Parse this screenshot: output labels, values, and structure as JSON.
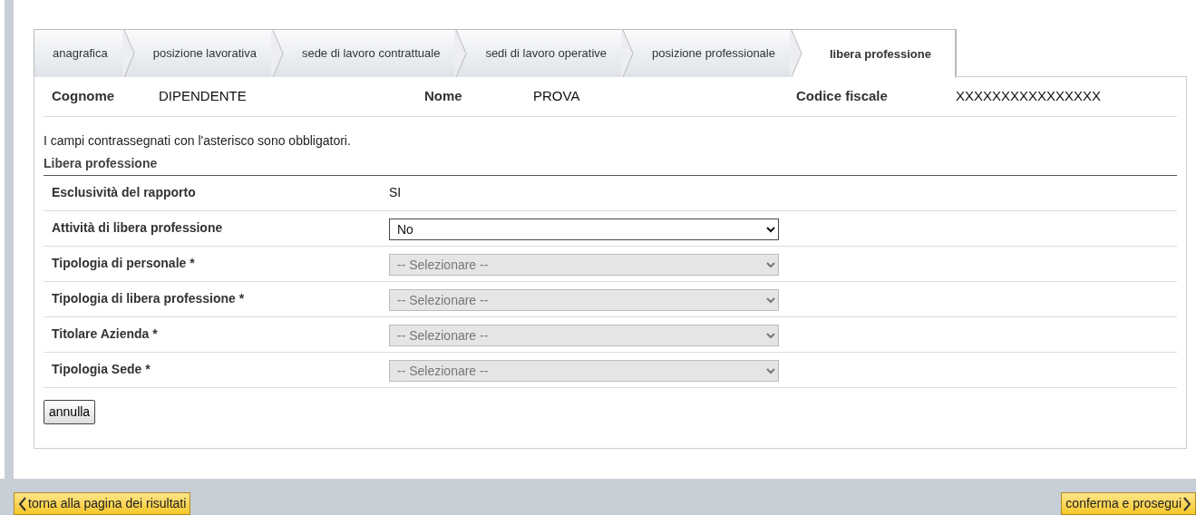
{
  "tabs": [
    {
      "label": "anagrafica",
      "selected": false
    },
    {
      "label": "posizione lavorativa",
      "selected": false
    },
    {
      "label": "sede di lavoro contrattuale",
      "selected": false
    },
    {
      "label": "sedi di lavoro operative",
      "selected": false
    },
    {
      "label": "posizione professionale",
      "selected": false
    },
    {
      "label": "libera professione",
      "selected": true
    }
  ],
  "header": [
    {
      "label": "Cognome",
      "value": "DIPENDENTE"
    },
    {
      "label": "Nome",
      "value": "PROVA"
    },
    {
      "label": "Codice fiscale",
      "value": "XXXXXXXXXXXXXXXX"
    }
  ],
  "note": "I campi contrassegnati con l'asterisco sono obbligatori.",
  "section_title": "Libera professione",
  "fields": [
    {
      "kind": "text",
      "label": "Esclusività del rapporto",
      "value": "SI"
    },
    {
      "kind": "select",
      "label": "Attività di libera professione",
      "value": "No",
      "disabled": false
    },
    {
      "kind": "select",
      "label": "Tipologia di personale *",
      "value": "-- Selezionare --",
      "disabled": true
    },
    {
      "kind": "select",
      "label": "Tipologia di libera professione *",
      "value": "-- Selezionare --",
      "disabled": true
    },
    {
      "kind": "select",
      "label": "Titolare Azienda *",
      "value": "-- Selezionare --",
      "disabled": true
    },
    {
      "kind": "select",
      "label": "Tipologia Sede *",
      "value": "-- Selezionare --",
      "disabled": true
    }
  ],
  "cancel_button": "annulla",
  "footer": {
    "back_button": "torna alla pagina dei risultati",
    "next_button": "conferma e prosegui"
  }
}
